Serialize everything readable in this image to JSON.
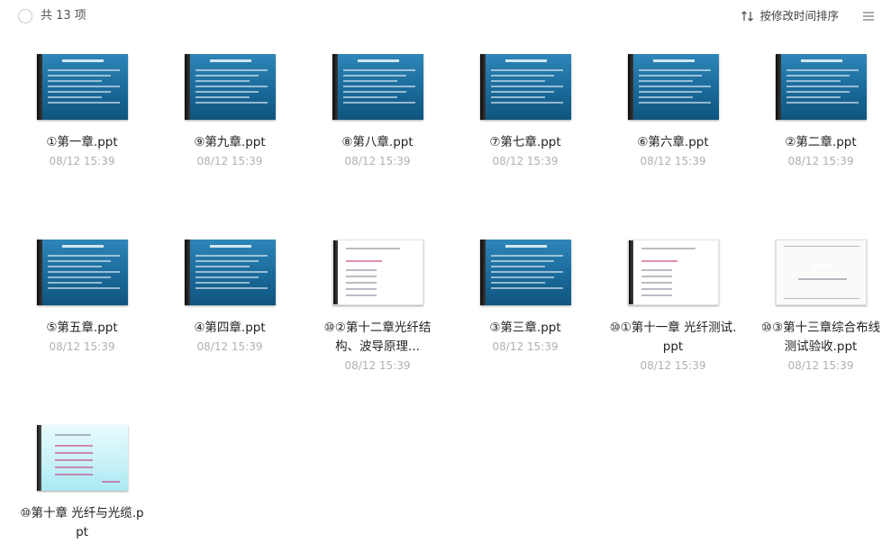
{
  "header": {
    "count_label": "共 13 项",
    "sort_label": "按修改时间排序"
  },
  "files": [
    {
      "name": "①第一章.ppt",
      "date": "08/12 15:39",
      "thumb": "blue"
    },
    {
      "name": "⑨第九章.ppt",
      "date": "08/12 15:39",
      "thumb": "blue"
    },
    {
      "name": "⑧第八章.ppt",
      "date": "08/12 15:39",
      "thumb": "blue"
    },
    {
      "name": "⑦第七章.ppt",
      "date": "08/12 15:39",
      "thumb": "blue"
    },
    {
      "name": "⑥第六章.ppt",
      "date": "08/12 15:39",
      "thumb": "blue"
    },
    {
      "name": "②第二章.ppt",
      "date": "08/12 15:39",
      "thumb": "blue"
    },
    {
      "name": "⑤第五章.ppt",
      "date": "08/12 15:39",
      "thumb": "blue"
    },
    {
      "name": "④第四章.ppt",
      "date": "08/12 15:39",
      "thumb": "blue"
    },
    {
      "name": "⑩②第十二章光纤结构、波导原理...",
      "date": "08/12 15:39",
      "thumb": "white"
    },
    {
      "name": "③第三章.ppt",
      "date": "08/12 15:39",
      "thumb": "blue"
    },
    {
      "name": "⑩①第十一章 光纤测试.ppt",
      "date": "08/12 15:39",
      "thumb": "white"
    },
    {
      "name": "⑩③第十三章综合布线测试验收.ppt",
      "date": "08/12 15:39",
      "thumb": "paper"
    },
    {
      "name": "⑩第十章 光纤与光缆.ppt",
      "date": "",
      "thumb": "cyan"
    }
  ],
  "icons": {
    "select_all": "circle-checkbox-icon",
    "sort": "sort-arrows-icon",
    "menu": "list-menu-icon"
  }
}
